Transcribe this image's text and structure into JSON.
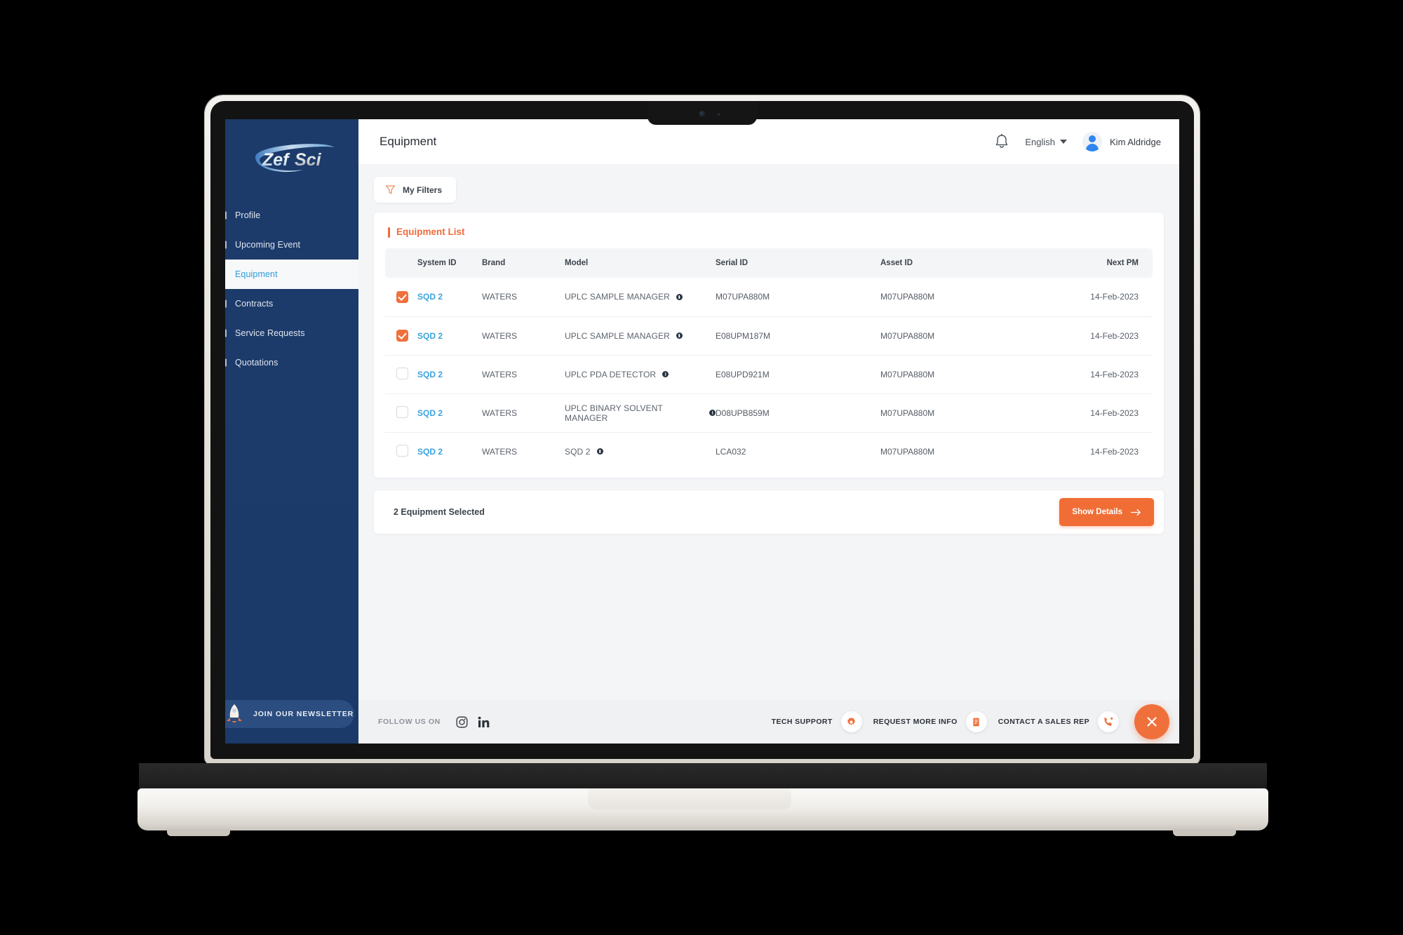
{
  "brand": {
    "logo_text": "ZefSci",
    "accent": "#f0703c",
    "sidebar_bg": "#1c3b6b",
    "link_blue": "#3ba3dd"
  },
  "sidebar": {
    "items": [
      {
        "label": "Profile",
        "active": false
      },
      {
        "label": "Upcoming Event",
        "active": false
      },
      {
        "label": "Equipment",
        "active": true
      },
      {
        "label": "Contracts",
        "active": false
      },
      {
        "label": "Service Requests",
        "active": false
      },
      {
        "label": "Quotations",
        "active": false
      }
    ],
    "newsletter_label": "JOIN OUR NEWSLETTER"
  },
  "topbar": {
    "title": "Equipment",
    "language": "English",
    "user_name": "Kim Aldridge"
  },
  "toolbar": {
    "filters_label": "My Filters"
  },
  "equipment_card": {
    "title": "Equipment List",
    "columns": [
      "",
      "System ID",
      "Brand",
      "Model",
      "Serial ID",
      "Asset ID",
      "Next PM"
    ],
    "rows": [
      {
        "checked": true,
        "system_id": "SQD 2",
        "brand": "WATERS",
        "model": "UPLC SAMPLE MANAGER",
        "serial_id": "M07UPA880M",
        "asset_id": "M07UPA880M",
        "next_pm": "14-Feb-2023"
      },
      {
        "checked": true,
        "system_id": "SQD 2",
        "brand": "WATERS",
        "model": "UPLC SAMPLE MANAGER",
        "serial_id": "E08UPM187M",
        "asset_id": "M07UPA880M",
        "next_pm": "14-Feb-2023"
      },
      {
        "checked": false,
        "system_id": "SQD 2",
        "brand": "WATERS",
        "model": "UPLC PDA DETECTOR",
        "serial_id": "E08UPD921M",
        "asset_id": "M07UPA880M",
        "next_pm": "14-Feb-2023"
      },
      {
        "checked": false,
        "system_id": "SQD 2",
        "brand": "WATERS",
        "model": "UPLC BINARY SOLVENT MANAGER",
        "serial_id": "D08UPB859M",
        "asset_id": "M07UPA880M",
        "next_pm": "14-Feb-2023"
      },
      {
        "checked": false,
        "system_id": "SQD 2",
        "brand": "WATERS",
        "model": "SQD 2",
        "serial_id": "LCA032",
        "asset_id": "M07UPA880M",
        "next_pm": "14-Feb-2023"
      }
    ]
  },
  "selection_bar": {
    "text": "2 Equipment Selected",
    "button_label": "Show Details"
  },
  "footer": {
    "follow_label": "FOLLOW US ON",
    "socials": [
      "instagram-icon",
      "linkedin-icon"
    ],
    "actions": [
      {
        "label": "TECH SUPPORT",
        "icon": "gear-icon"
      },
      {
        "label": "REQUEST MORE INFO",
        "icon": "document-icon"
      },
      {
        "label": "CONTACT A SALES REP",
        "icon": "phone-icon"
      }
    ],
    "close_icon": "close-icon"
  }
}
